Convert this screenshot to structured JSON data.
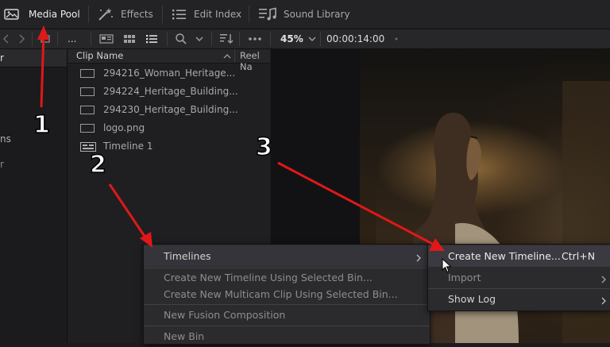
{
  "toolbar": {
    "media_pool": "Media Pool",
    "effects": "Effects",
    "edit_index": "Edit Index",
    "sound_library": "Sound Library"
  },
  "subtoolbar": {
    "ellipsis": "...",
    "zoom": "45%",
    "timecode": "00:00:14:00"
  },
  "bins": {
    "header_fragment": "r",
    "items": [
      "ns",
      "r"
    ]
  },
  "clip_list": {
    "col_clip_name": "Clip Name",
    "col_reel_name": "Reel Na",
    "clips": [
      {
        "name": "294216_Woman_Heritage...",
        "type": "video"
      },
      {
        "name": "294224_Heritage_Building...",
        "type": "video"
      },
      {
        "name": "294230_Heritage_Building...",
        "type": "video"
      },
      {
        "name": "logo.png",
        "type": "image"
      },
      {
        "name": "Timeline 1",
        "type": "timeline"
      }
    ]
  },
  "context_menu": {
    "items": [
      {
        "label": "Timelines",
        "enabled": true,
        "submenu": true
      },
      {
        "label": "Create New Timeline Using Selected Bin...",
        "enabled": false
      },
      {
        "label": "Create New Multicam Clip Using Selected Bin...",
        "enabled": false
      },
      {
        "label": "New Fusion Composition",
        "enabled": false
      },
      {
        "label": "New Bin",
        "enabled": false
      }
    ]
  },
  "submenu": {
    "items": [
      {
        "label": "Create New Timeline...",
        "shortcut": "Ctrl+N",
        "enabled": true,
        "highlighted": true
      },
      {
        "label": "Import",
        "enabled": false,
        "submenu": true
      },
      {
        "label": "Show Log",
        "enabled": true,
        "submenu": true
      }
    ]
  },
  "annotations": {
    "labels": [
      "1",
      "2",
      "3"
    ],
    "color": "#e01818"
  },
  "colors": {
    "toolbar_bg": "#232326",
    "panel_bg": "#1f1f22",
    "menu_bg": "#2b2b2e",
    "text": "#c8c8c8"
  }
}
